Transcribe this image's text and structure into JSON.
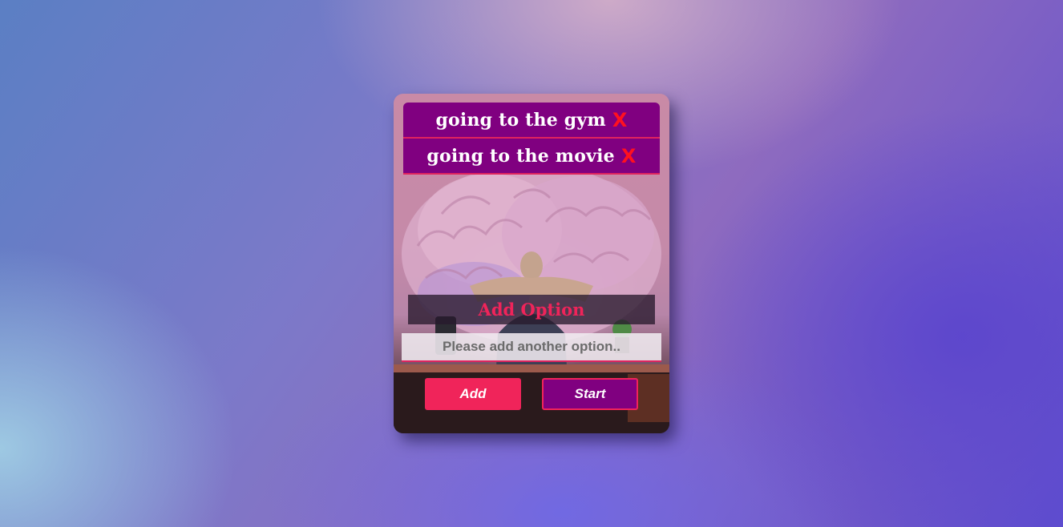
{
  "options": [
    {
      "label": "going to the gym",
      "remove_label": "X"
    },
    {
      "label": "going to the movie",
      "remove_label": "X"
    }
  ],
  "add_option": {
    "heading": "Add Option",
    "input_value": "",
    "input_placeholder": "Please add another option.."
  },
  "buttons": {
    "add_label": "Add",
    "start_label": "Start"
  },
  "colors": {
    "option_bg": "#800080",
    "accent": "#f0245a",
    "remove_x": "#ff1020"
  },
  "background_image": "person-thinking-with-brain-photo"
}
